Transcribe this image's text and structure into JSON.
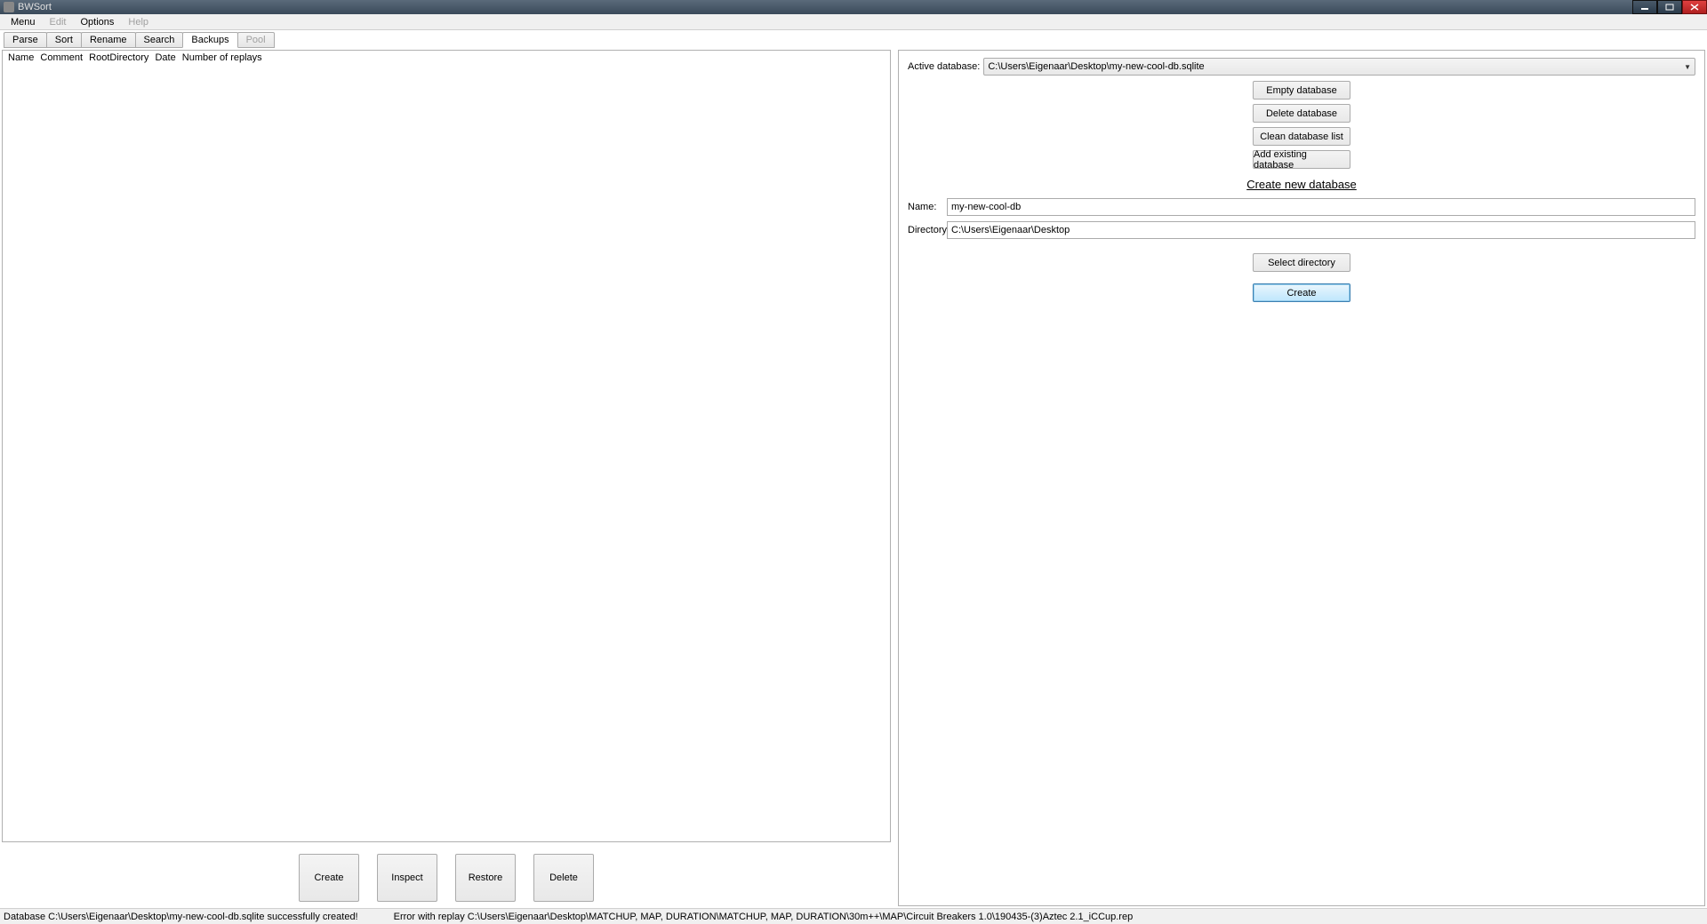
{
  "window": {
    "title": "BWSort"
  },
  "menubar": {
    "items": [
      "Menu",
      "Edit",
      "Options",
      "Help"
    ],
    "disabled": [
      1,
      3
    ]
  },
  "tabs": {
    "items": [
      "Parse",
      "Sort",
      "Rename",
      "Search",
      "Backups",
      "Pool"
    ],
    "active": 4,
    "disabled": [
      5
    ]
  },
  "table": {
    "columns": [
      "Name",
      "Comment",
      "RootDirectory",
      "Date",
      "Number of replays"
    ]
  },
  "bottomButtons": {
    "create": "Create",
    "inspect": "Inspect",
    "restore": "Restore",
    "delete": "Delete"
  },
  "right": {
    "activeDbLabel": "Active database:",
    "activeDb": "C:\\Users\\Eigenaar\\Desktop\\my-new-cool-db.sqlite",
    "buttons": {
      "empty": "Empty database",
      "delete": "Delete database",
      "clean": "Clean database list",
      "addExisting": "Add existing database",
      "selectDir": "Select directory",
      "create": "Create"
    },
    "createTitle": "Create new database",
    "nameLabel": "Name:",
    "nameValue": "my-new-cool-db",
    "dirLabel": "Directory:",
    "dirValue": "C:\\Users\\Eigenaar\\Desktop"
  },
  "status": {
    "left": "Database C:\\Users\\Eigenaar\\Desktop\\my-new-cool-db.sqlite successfully created!",
    "right": "Error with replay C:\\Users\\Eigenaar\\Desktop\\MATCHUP, MAP, DURATION\\MATCHUP, MAP, DURATION\\30m++\\MAP\\Circuit Breakers 1.0\\190435-(3)Aztec 2.1_iCCup.rep"
  }
}
